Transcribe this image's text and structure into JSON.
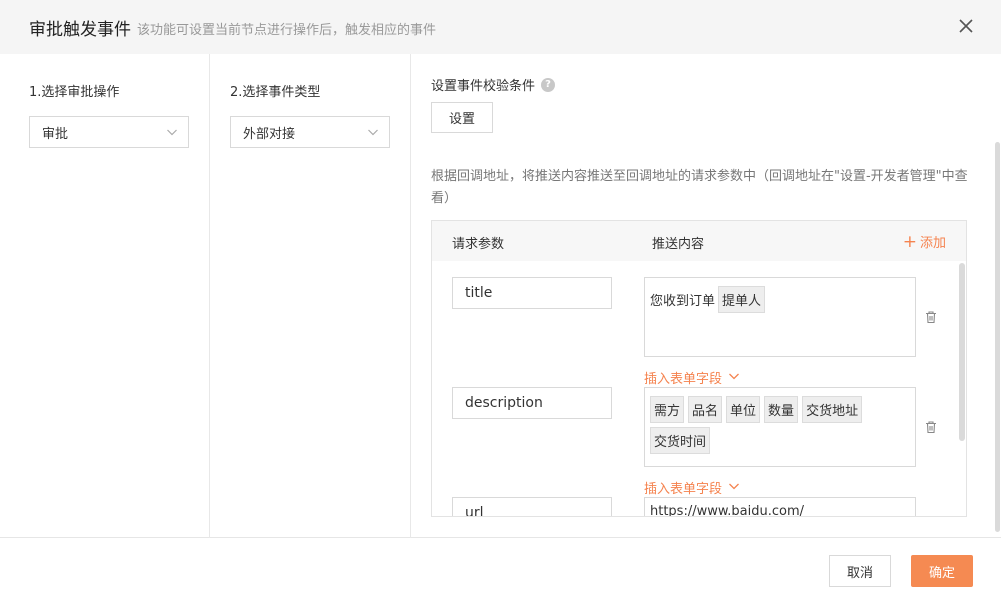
{
  "dialog": {
    "title": "审批触发事件",
    "subtitle": "该功能可设置当前节点进行操作后，触发相应的事件"
  },
  "step1": {
    "label": "1.选择审批操作",
    "value": "审批"
  },
  "step2": {
    "label": "2.选择事件类型",
    "value": "外部对接"
  },
  "condition": {
    "label": "设置事件校验条件",
    "button": "设置"
  },
  "description": "根据回调地址，将推送内容推送至回调地址的请求参数中（回调地址在\"设置-开发者管理\"中查看）",
  "table": {
    "col_param": "请求参数",
    "col_content": "推送内容",
    "add_label": "添加",
    "insert_label": "插入表单字段",
    "rows": [
      {
        "param": "title",
        "text": "您收到订单",
        "tags": [
          "提单人"
        ]
      },
      {
        "param": "description",
        "text": "",
        "tags": [
          "需方",
          "品名",
          "单位",
          "数量",
          "交货地址",
          "交货时间"
        ]
      },
      {
        "param": "url",
        "text": "https://www.baidu.com/",
        "tags": []
      }
    ]
  },
  "footer": {
    "cancel": "取消",
    "ok": "确定"
  },
  "colors": {
    "accent": "#f58a52",
    "link": "#f5834f"
  },
  "icons": [
    "close-icon",
    "chevron-down-icon",
    "help-icon",
    "plus-icon",
    "trash-icon"
  ]
}
